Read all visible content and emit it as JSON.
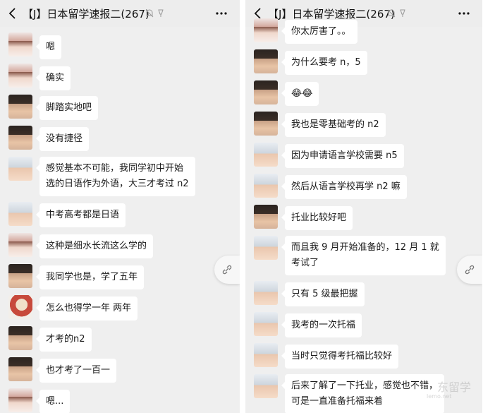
{
  "colors": {
    "chat_bg": "#efefef",
    "header_bg": "#ededed",
    "bubble_bg": "#ffffff",
    "text": "#1a1a1a"
  },
  "left": {
    "header": {
      "title": "【J】日本留学速报二(267)",
      "back_icon": "chevron-left-icon",
      "more_icon": "more-dots-icon"
    },
    "messages": [
      {
        "avatar": "avatar-girl",
        "text": "嗯"
      },
      {
        "avatar": "avatar-girl",
        "text": "确实"
      },
      {
        "avatar": "avatar-boy",
        "text": "脚踏实地吧"
      },
      {
        "avatar": "avatar-boy",
        "text": "没有捷径"
      },
      {
        "avatar": "avatar-smiley",
        "lines": [
          "感觉基本不可能，我同学初中开始",
          "选的日语作为外语，大三才考过 n2"
        ]
      },
      {
        "avatar": "avatar-smiley",
        "text": "中考高考都是日语"
      },
      {
        "avatar": "avatar-girl",
        "text": "这种是细水长流这么学的"
      },
      {
        "avatar": "avatar-boy",
        "text": "我同学也是，学了五年"
      },
      {
        "avatar": "avatar-red",
        "text": "怎么也得学一年 两年"
      },
      {
        "avatar": "avatar-boy",
        "text": "才考的n2"
      },
      {
        "avatar": "avatar-boy",
        "text": "也才考了一百一"
      },
      {
        "avatar": "avatar-girl",
        "text": "嗯..."
      }
    ]
  },
  "right": {
    "header": {
      "title": "【J】日本留学速报二(267)",
      "back_icon": "chevron-left-icon",
      "more_icon": "more-dots-icon"
    },
    "messages": [
      {
        "avatar": "avatar-girl",
        "text": "你太厉害了。。"
      },
      {
        "avatar": "avatar-boy",
        "text": "为什么要考 n，5"
      },
      {
        "avatar": "avatar-boy",
        "text": "😂😂"
      },
      {
        "avatar": "avatar-boy",
        "text": "我也是零基础考的 n2"
      },
      {
        "avatar": "avatar-smiley",
        "text": "因为申请语言学校需要 n5"
      },
      {
        "avatar": "avatar-smiley",
        "text": "然后从语言学校再学 n2 嘛"
      },
      {
        "avatar": "avatar-boy",
        "text": "托业比较好吧"
      },
      {
        "avatar": "avatar-smiley",
        "lines": [
          "而且我 9 月开始准备的，12 月 1 就",
          "考试了"
        ]
      },
      {
        "avatar": "avatar-smiley",
        "text": "只有 5 级最把握"
      },
      {
        "avatar": "avatar-smiley",
        "text": "我考的一次托福"
      },
      {
        "avatar": "avatar-smiley",
        "text": "当时只觉得考托福比较好"
      },
      {
        "avatar": "avatar-smiley",
        "lines": [
          "后来了解了一下托业，感觉也不错，",
          "可是一直准备托福来着"
        ]
      }
    ]
  },
  "watermark": {
    "text": "东留学",
    "url": "lemo.net"
  }
}
